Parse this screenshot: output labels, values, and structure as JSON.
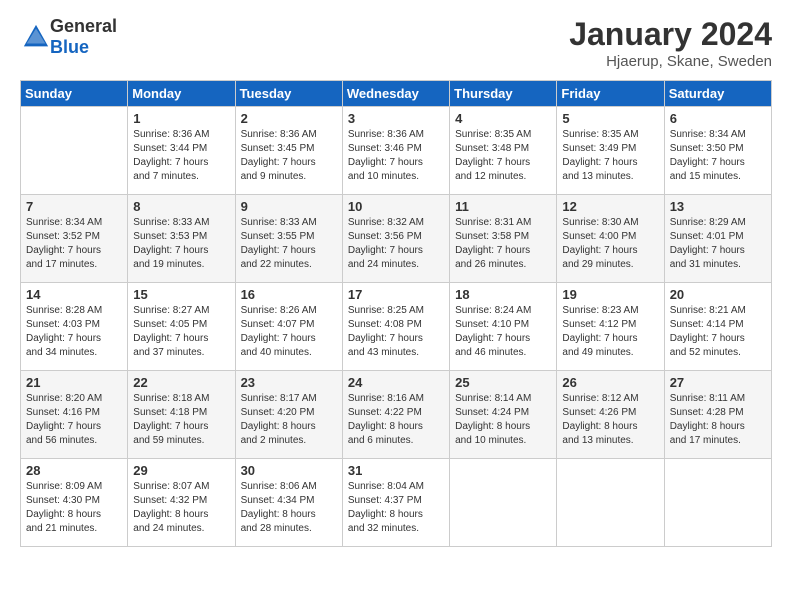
{
  "logo": {
    "general": "General",
    "blue": "Blue"
  },
  "header": {
    "month": "January 2024",
    "location": "Hjaerup, Skane, Sweden"
  },
  "weekdays": [
    "Sunday",
    "Monday",
    "Tuesday",
    "Wednesday",
    "Thursday",
    "Friday",
    "Saturday"
  ],
  "weeks": [
    [
      {
        "day": "",
        "info": ""
      },
      {
        "day": "1",
        "info": "Sunrise: 8:36 AM\nSunset: 3:44 PM\nDaylight: 7 hours\nand 7 minutes."
      },
      {
        "day": "2",
        "info": "Sunrise: 8:36 AM\nSunset: 3:45 PM\nDaylight: 7 hours\nand 9 minutes."
      },
      {
        "day": "3",
        "info": "Sunrise: 8:36 AM\nSunset: 3:46 PM\nDaylight: 7 hours\nand 10 minutes."
      },
      {
        "day": "4",
        "info": "Sunrise: 8:35 AM\nSunset: 3:48 PM\nDaylight: 7 hours\nand 12 minutes."
      },
      {
        "day": "5",
        "info": "Sunrise: 8:35 AM\nSunset: 3:49 PM\nDaylight: 7 hours\nand 13 minutes."
      },
      {
        "day": "6",
        "info": "Sunrise: 8:34 AM\nSunset: 3:50 PM\nDaylight: 7 hours\nand 15 minutes."
      }
    ],
    [
      {
        "day": "7",
        "info": "Sunrise: 8:34 AM\nSunset: 3:52 PM\nDaylight: 7 hours\nand 17 minutes."
      },
      {
        "day": "8",
        "info": "Sunrise: 8:33 AM\nSunset: 3:53 PM\nDaylight: 7 hours\nand 19 minutes."
      },
      {
        "day": "9",
        "info": "Sunrise: 8:33 AM\nSunset: 3:55 PM\nDaylight: 7 hours\nand 22 minutes."
      },
      {
        "day": "10",
        "info": "Sunrise: 8:32 AM\nSunset: 3:56 PM\nDaylight: 7 hours\nand 24 minutes."
      },
      {
        "day": "11",
        "info": "Sunrise: 8:31 AM\nSunset: 3:58 PM\nDaylight: 7 hours\nand 26 minutes."
      },
      {
        "day": "12",
        "info": "Sunrise: 8:30 AM\nSunset: 4:00 PM\nDaylight: 7 hours\nand 29 minutes."
      },
      {
        "day": "13",
        "info": "Sunrise: 8:29 AM\nSunset: 4:01 PM\nDaylight: 7 hours\nand 31 minutes."
      }
    ],
    [
      {
        "day": "14",
        "info": "Sunrise: 8:28 AM\nSunset: 4:03 PM\nDaylight: 7 hours\nand 34 minutes."
      },
      {
        "day": "15",
        "info": "Sunrise: 8:27 AM\nSunset: 4:05 PM\nDaylight: 7 hours\nand 37 minutes."
      },
      {
        "day": "16",
        "info": "Sunrise: 8:26 AM\nSunset: 4:07 PM\nDaylight: 7 hours\nand 40 minutes."
      },
      {
        "day": "17",
        "info": "Sunrise: 8:25 AM\nSunset: 4:08 PM\nDaylight: 7 hours\nand 43 minutes."
      },
      {
        "day": "18",
        "info": "Sunrise: 8:24 AM\nSunset: 4:10 PM\nDaylight: 7 hours\nand 46 minutes."
      },
      {
        "day": "19",
        "info": "Sunrise: 8:23 AM\nSunset: 4:12 PM\nDaylight: 7 hours\nand 49 minutes."
      },
      {
        "day": "20",
        "info": "Sunrise: 8:21 AM\nSunset: 4:14 PM\nDaylight: 7 hours\nand 52 minutes."
      }
    ],
    [
      {
        "day": "21",
        "info": "Sunrise: 8:20 AM\nSunset: 4:16 PM\nDaylight: 7 hours\nand 56 minutes."
      },
      {
        "day": "22",
        "info": "Sunrise: 8:18 AM\nSunset: 4:18 PM\nDaylight: 7 hours\nand 59 minutes."
      },
      {
        "day": "23",
        "info": "Sunrise: 8:17 AM\nSunset: 4:20 PM\nDaylight: 8 hours\nand 2 minutes."
      },
      {
        "day": "24",
        "info": "Sunrise: 8:16 AM\nSunset: 4:22 PM\nDaylight: 8 hours\nand 6 minutes."
      },
      {
        "day": "25",
        "info": "Sunrise: 8:14 AM\nSunset: 4:24 PM\nDaylight: 8 hours\nand 10 minutes."
      },
      {
        "day": "26",
        "info": "Sunrise: 8:12 AM\nSunset: 4:26 PM\nDaylight: 8 hours\nand 13 minutes."
      },
      {
        "day": "27",
        "info": "Sunrise: 8:11 AM\nSunset: 4:28 PM\nDaylight: 8 hours\nand 17 minutes."
      }
    ],
    [
      {
        "day": "28",
        "info": "Sunrise: 8:09 AM\nSunset: 4:30 PM\nDaylight: 8 hours\nand 21 minutes."
      },
      {
        "day": "29",
        "info": "Sunrise: 8:07 AM\nSunset: 4:32 PM\nDaylight: 8 hours\nand 24 minutes."
      },
      {
        "day": "30",
        "info": "Sunrise: 8:06 AM\nSunset: 4:34 PM\nDaylight: 8 hours\nand 28 minutes."
      },
      {
        "day": "31",
        "info": "Sunrise: 8:04 AM\nSunset: 4:37 PM\nDaylight: 8 hours\nand 32 minutes."
      },
      {
        "day": "",
        "info": ""
      },
      {
        "day": "",
        "info": ""
      },
      {
        "day": "",
        "info": ""
      }
    ]
  ]
}
